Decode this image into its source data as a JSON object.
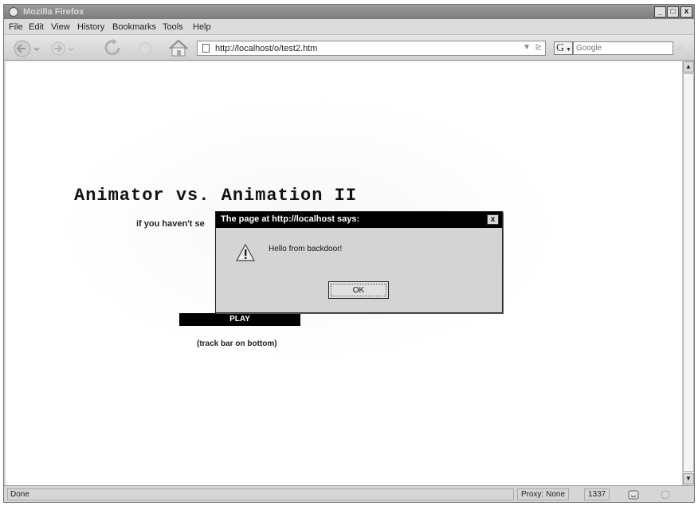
{
  "window": {
    "title": "Mozilla Firefox",
    "controls": {
      "minimize": "_",
      "maximize": "□",
      "close": "x"
    }
  },
  "menubar": {
    "items": [
      "File",
      "Edit",
      "View",
      "History",
      "Bookmarks",
      "Tools",
      "Help"
    ]
  },
  "navbar": {
    "url": "http://localhost/o/test2.htm",
    "search_engine_letter": "G",
    "search_placeholder": "Google",
    "icons": [
      "back-icon",
      "forward-icon",
      "reload-icon",
      "stop-icon",
      "home-icon",
      "page-icon",
      "go-arrow-icon",
      "feed-icon",
      "search-engine-icon",
      "search-go-icon"
    ]
  },
  "page": {
    "heading": "Animator vs. Animation II",
    "subtext": "if you haven't se",
    "play_label": "PLAY",
    "track_note": "(track bar on bottom)"
  },
  "dialog": {
    "title": "The page at http://localhost says:",
    "message": "Hello from backdoor!",
    "ok_label": "OK",
    "close_glyph": "x"
  },
  "statusbar": {
    "status": "Done",
    "proxy": "Proxy: None",
    "port": "1337"
  },
  "colors": {
    "dialog_titlebar": "#000000",
    "play_button": "#000000",
    "chrome": "#d4d4d4"
  }
}
